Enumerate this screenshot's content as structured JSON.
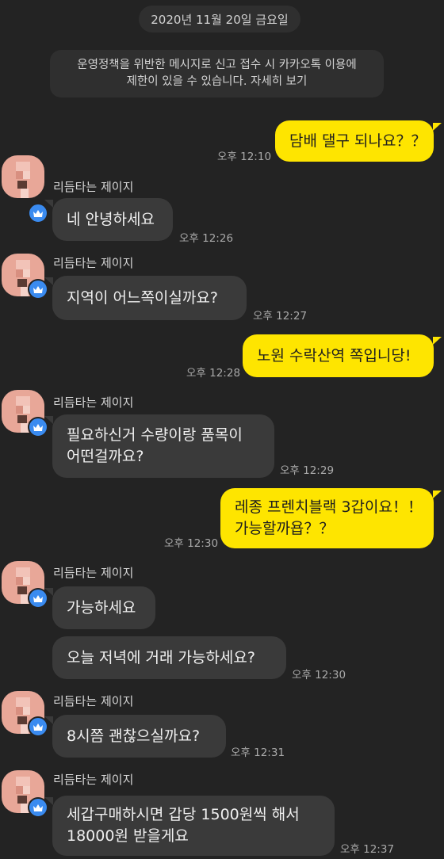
{
  "chat": {
    "date": "2020년 11월 20일 금요일",
    "notice_line1": "운영정책을 위반한 메시지로 신고 접수 시 카카오톡 이용에",
    "notice_line2": "제한이 있을 수 있습니다. 자세히 보기",
    "sender_name": "리듬타는 제이지",
    "messages": [
      {
        "lines": [
          "담배 댈구 되나요？？"
        ],
        "time": "오후 12:10"
      },
      {
        "lines": [
          "네 안녕하세요"
        ],
        "time": "오후 12:26"
      },
      {
        "lines": [
          "지역이 어느쪽이실까요?"
        ],
        "time": "오후 12:27"
      },
      {
        "lines": [
          "노원 수락산역 쪽입니당!"
        ],
        "time": "오후 12:28"
      },
      {
        "lines": [
          "필요하신거 수량이랑 품목이",
          "어떤걸까요?"
        ],
        "time": "오후 12:29"
      },
      {
        "lines": [
          "레종 프렌치블랙 3갑이요！！",
          "가능할까욥？？"
        ],
        "time": "오후 12:30"
      },
      {
        "lines": [
          "가능하세요"
        ],
        "time": ""
      },
      {
        "lines": [
          "오늘 저녁에 거래 가능하세요?"
        ],
        "time": "오후 12:30"
      },
      {
        "lines": [
          "8시쯤 괜찮으실까요?"
        ],
        "time": "오후 12:31"
      },
      {
        "lines": [
          "세갑구매하시면 갑당 1500원씩 해서",
          "18000원 받을게요"
        ],
        "time": "오후 12:37"
      }
    ]
  },
  "colors": {
    "background": "#232323",
    "incoming_bubble": "#3a3a3a",
    "outgoing_bubble": "#fee500",
    "badge": "#3a8bf0"
  }
}
